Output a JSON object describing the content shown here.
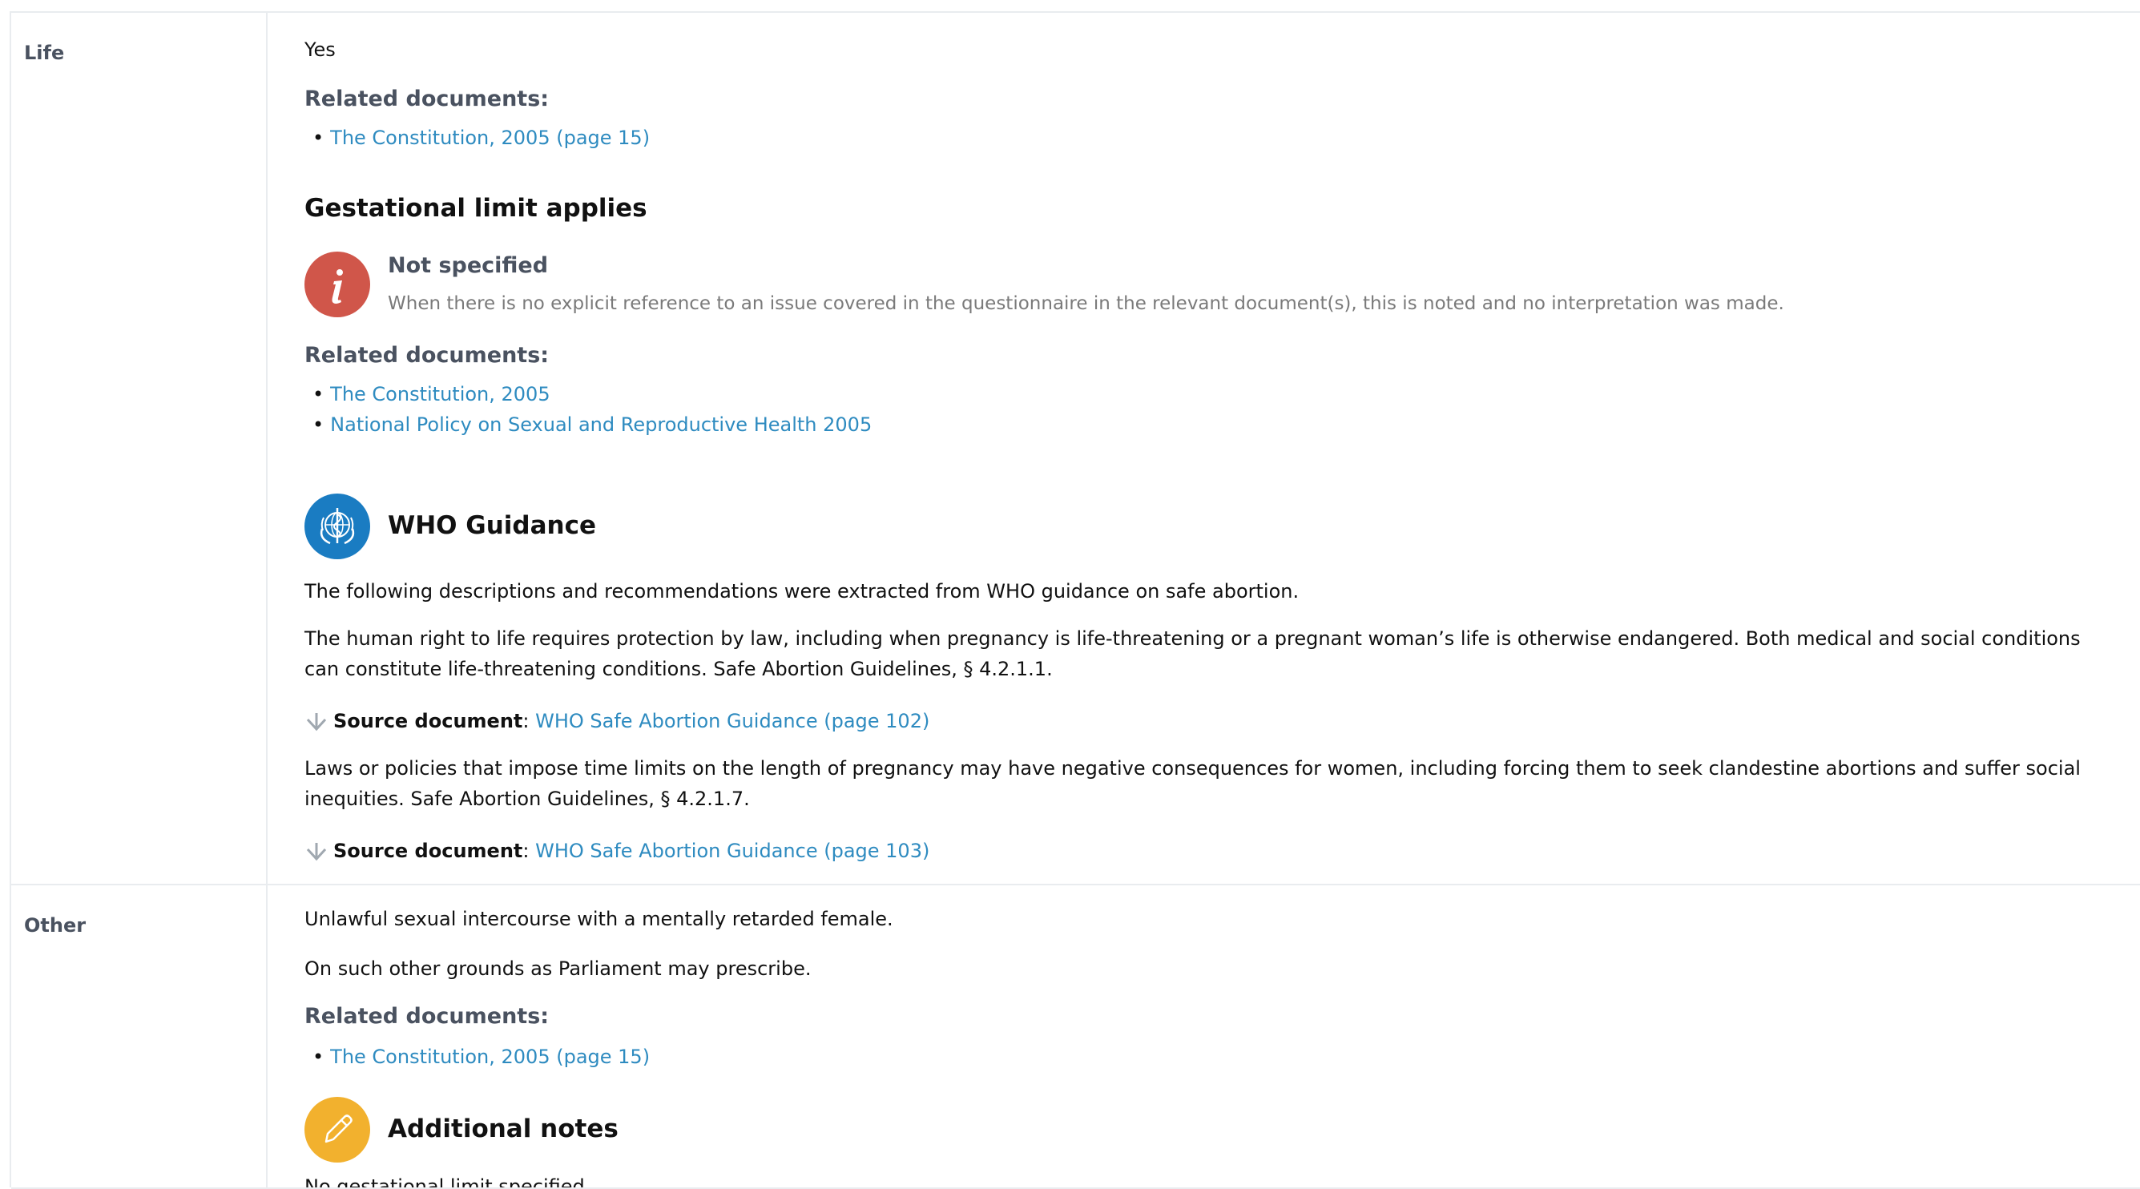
{
  "rows": {
    "life": {
      "label": "Life",
      "answer": "Yes",
      "related_heading_1": "Related documents:",
      "docs_1": [
        "The Constitution, 2005 (page 15)"
      ],
      "gestational_heading": "Gestational limit applies",
      "not_specified": {
        "title": "Not specified",
        "description": "When there is no explicit reference to an issue covered in the questionnaire in the relevant document(s), this is noted and no interpretation was made."
      },
      "related_heading_2": "Related documents:",
      "docs_2": [
        "The Constitution, 2005",
        "National Policy on Sexual and Reproductive Health 2005"
      ],
      "who": {
        "title": "WHO Guidance",
        "intro": "The following descriptions and recommendations were extracted from WHO guidance on safe abortion.",
        "para1": "The human right to life requires protection by law, including when pregnancy is life-threatening or a pregnant woman’s life is otherwise endangered. Both medical and social conditions can constitute life-threatening conditions. Safe Abortion Guidelines, § 4.2.1.1.",
        "source_label": "Source document",
        "source1": "WHO Safe Abortion Guidance (page 102)",
        "para2": "Laws or policies that impose time limits on the length of pregnancy may have negative consequences for women, including forcing them to seek clandestine abortions and suffer social inequities. Safe Abortion Guidelines, § 4.2.1.7.",
        "source2": "WHO Safe Abortion Guidance (page 103)"
      }
    },
    "other": {
      "label": "Other",
      "line1": "Unlawful sexual intercourse with a mentally retarded female.",
      "line2": "On such other grounds as Parliament may prescribe.",
      "related_heading": "Related documents:",
      "docs": [
        "The Constitution, 2005 (page 15)"
      ],
      "notes_title": "Additional notes",
      "notes_text": "No gestational limit specified."
    }
  },
  "colors": {
    "link": "#2e8bc0",
    "info_icon": "#d0564a",
    "who_icon": "#1a7cc2",
    "notes_icon": "#f2b12e",
    "heading_muted": "#4a5260"
  },
  "icons": [
    "info-icon",
    "who-emblem-icon",
    "pencil-icon",
    "arrow-down-icon"
  ]
}
